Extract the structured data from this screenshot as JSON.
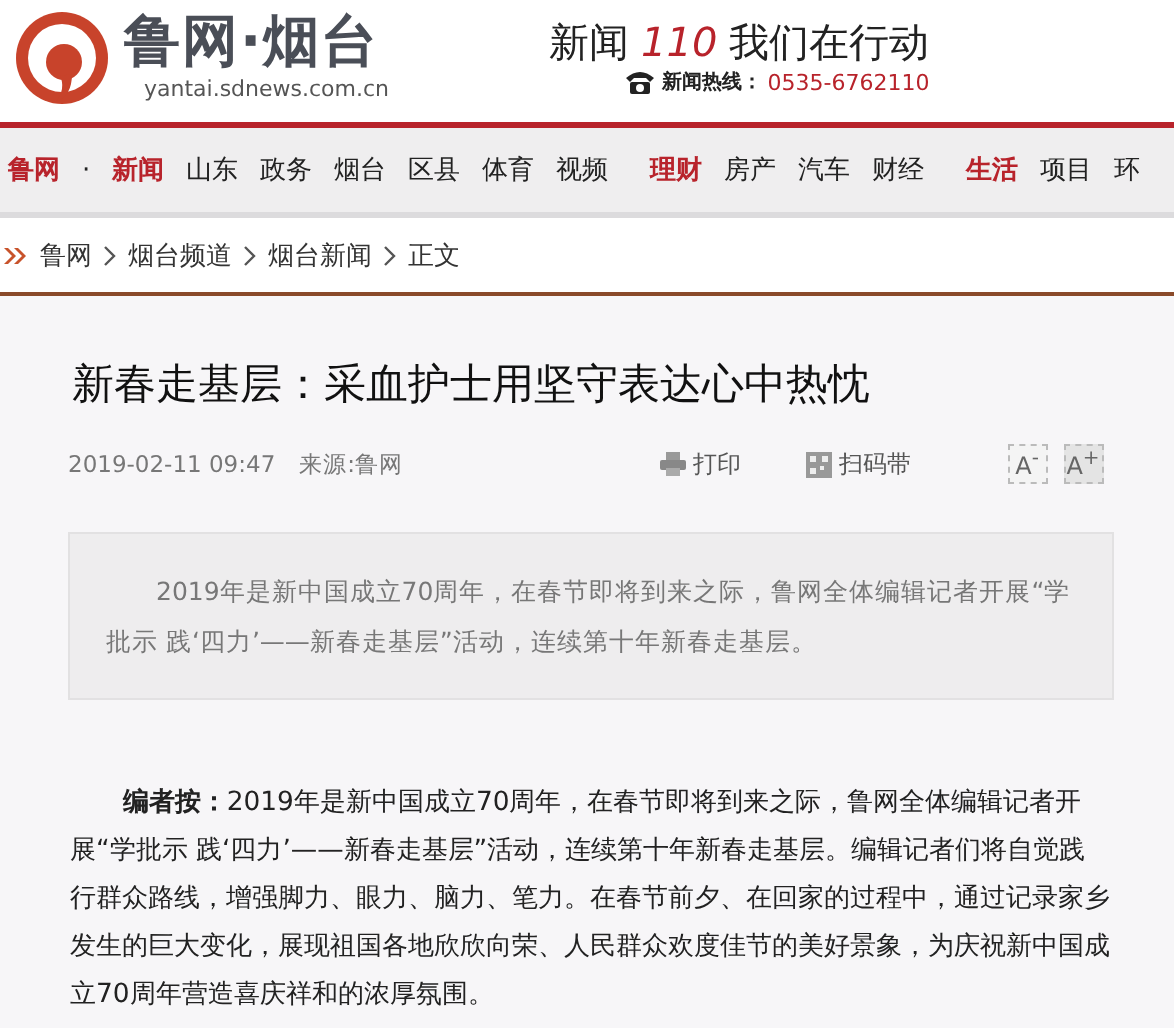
{
  "header": {
    "site_name": "鲁网·烟台",
    "site_url": "yantai.sdnews.com.cn",
    "slogan_before": "新闻",
    "slogan_number": "110",
    "slogan_after": "我们在行动",
    "hotline_label": "新闻热线：",
    "hotline_number": "0535-6762110"
  },
  "nav_groups": [
    {
      "items": [
        {
          "label": "鲁网",
          "highlight": true
        },
        {
          "label": "·",
          "highlight": false
        },
        {
          "label": "新闻",
          "highlight": true
        },
        {
          "label": "山东",
          "highlight": false
        },
        {
          "label": "政务",
          "highlight": false
        },
        {
          "label": "烟台",
          "highlight": false
        },
        {
          "label": "区县",
          "highlight": false
        },
        {
          "label": "体育",
          "highlight": false
        },
        {
          "label": "视频",
          "highlight": false
        }
      ]
    },
    {
      "items": [
        {
          "label": "理财",
          "highlight": true
        },
        {
          "label": "房产",
          "highlight": false
        },
        {
          "label": "汽车",
          "highlight": false
        },
        {
          "label": "财经",
          "highlight": false
        }
      ]
    },
    {
      "items": [
        {
          "label": "生活",
          "highlight": true
        },
        {
          "label": "项目",
          "highlight": false
        },
        {
          "label": "环",
          "highlight": false
        }
      ]
    }
  ],
  "breadcrumb": [
    "鲁网",
    "烟台频道",
    "烟台新闻",
    "正文"
  ],
  "article": {
    "title": "新春走基层：采血护士用坚守表达心中热忱",
    "date": "2019-02-11 09:47",
    "source": "来源:鲁网",
    "tools": [
      {
        "kind": "print",
        "label": "打印"
      },
      {
        "kind": "qr",
        "label": "扫码带"
      }
    ],
    "font_buttons": [
      {
        "label": "A",
        "sign": "-"
      },
      {
        "label": "A",
        "sign": "+"
      }
    ],
    "summary": "2019年是新中国成立70周年，在春节即将到来之际，鲁网全体编辑记者开展“学批示 践‘四力’——新春走基层”活动，连续第十年新春走基层。",
    "body": "**编者按：**2019年是新中国成立70周年，在春节即将到来之际，鲁网全体编辑记者开展“学批示 践‘四力’——新春走基层”活动，连续第十年新春走基层。编辑记者们将自觉践行群众路线，增强脚力、眼力、脑力、笔力。在春节前夕、在回家的过程中，通过记录家乡发生的巨大变化，展现祖国各地欣欣向荣、人民群众欢度佳节的美好景象，为庆祝新中国成立70周年营造喜庆祥和的浓厚氛围。"
  }
}
